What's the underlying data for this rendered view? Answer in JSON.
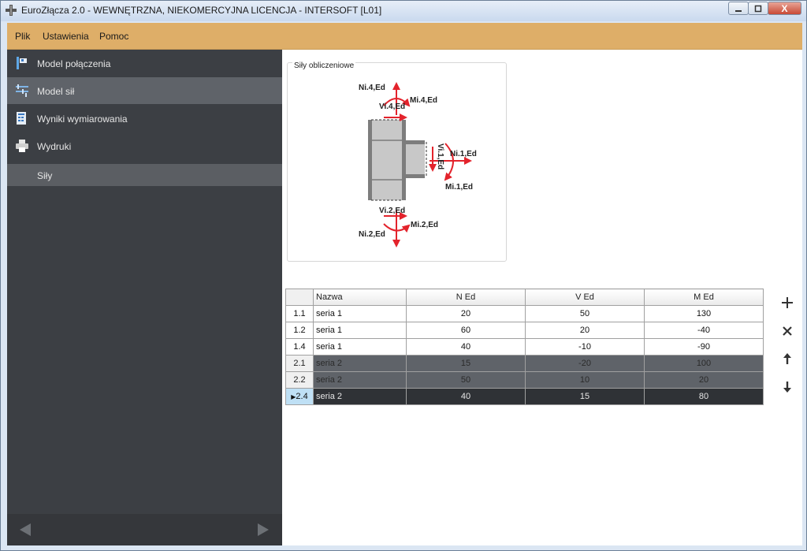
{
  "window": {
    "title": "EuroZłącza 2.0 - WEWNĘTRZNA, NIEKOMERCYJNA LICENCJA - INTERSOFT [L01]",
    "minimize_icon": "minimize-icon",
    "maximize_icon": "maximize-icon",
    "close_glyph": "X"
  },
  "menu": {
    "items": [
      "Plik",
      "Ustawienia",
      "Pomoc"
    ]
  },
  "sidebar": {
    "items": [
      {
        "label": "Model połączenia",
        "icon": "connection-model-icon"
      },
      {
        "label": "Model sił",
        "icon": "force-model-icon"
      },
      {
        "label": "Wyniki wymiarowania",
        "icon": "results-icon"
      },
      {
        "label": "Wydruki",
        "icon": "printer-icon"
      },
      {
        "label": "Siły",
        "icon": ""
      }
    ],
    "active_index": 1,
    "back_icon": "arrow-left-icon",
    "forward_icon": "arrow-right-icon"
  },
  "forces_panel": {
    "title": "Siły obliczeniowe",
    "labels": {
      "n4": "Ni.4,Ed",
      "v4": "Vi.4,Ed",
      "m4": "Mi.4,Ed",
      "n1": "Ni.1,Ed",
      "v1": "Vi.1,Ed",
      "m1": "Mi.1,Ed",
      "v2": "Vi.2,Ed",
      "n2": "Ni.2,Ed",
      "m2": "Mi.2,Ed"
    }
  },
  "table": {
    "headers": [
      "Nazwa",
      "N Ed",
      "V Ed",
      "M Ed"
    ],
    "rows": [
      {
        "id": "1.1",
        "name": "seria 1",
        "n": "20",
        "v": "50",
        "m": "130",
        "style": "white"
      },
      {
        "id": "1.2",
        "name": "seria 1",
        "n": "60",
        "v": "20",
        "m": "-40",
        "style": "white"
      },
      {
        "id": "1.4",
        "name": "seria 1",
        "n": "40",
        "v": "-10",
        "m": "-90",
        "style": "white"
      },
      {
        "id": "2.1",
        "name": "seria 2",
        "n": "15",
        "v": "-20",
        "m": "100",
        "style": "dark"
      },
      {
        "id": "2.2",
        "name": "seria 2",
        "n": "50",
        "v": "10",
        "m": "20",
        "style": "dark"
      },
      {
        "id": "2.4",
        "name": "seria 2",
        "n": "40",
        "v": "15",
        "m": "80",
        "style": "sel"
      }
    ],
    "actions": [
      "add-icon",
      "delete-icon",
      "move-up-icon",
      "move-down-icon"
    ]
  },
  "colors": {
    "menu": "#deae68",
    "sidebar": "#3c3f44",
    "accent_red": "#e3232c"
  }
}
